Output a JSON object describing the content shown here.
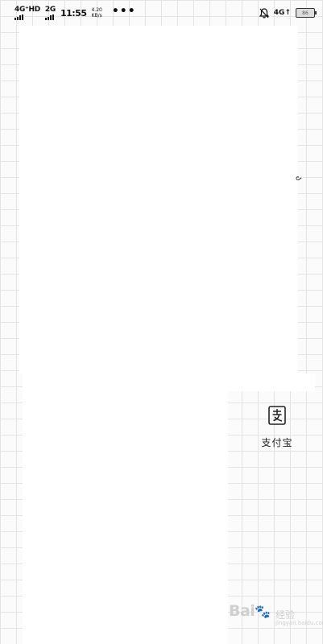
{
  "status_bar": {
    "signal1_label": "4G⁺HD",
    "signal2_label": "2G",
    "time": "11:55",
    "speed_value": "4.20",
    "speed_unit": "KB/s",
    "more": "•••",
    "network": "4G↑",
    "battery_label": "86"
  },
  "side_glyph": "ა",
  "app_shortcut": {
    "icon": "alipay-icon",
    "label": "支付宝"
  },
  "watermark": {
    "brand": "Bai",
    "paw": "🐾",
    "sub": "经验",
    "url": "jingyan.baidu.com"
  }
}
